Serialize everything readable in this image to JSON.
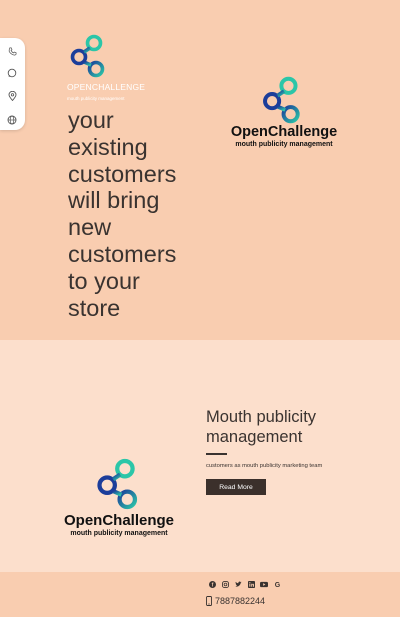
{
  "colors": {
    "hero_bg": "#f9cdb0",
    "section_bg": "#fcdfcc",
    "text_dark": "#3a3330",
    "button_bg": "#3b302b",
    "logo_blue": "#1c3d9a",
    "logo_teal": "#2bc6a8"
  },
  "contact_bar": {
    "icons": [
      "phone-icon",
      "whatsapp-icon",
      "location-pin-icon",
      "globe-icon"
    ]
  },
  "header_logo": {
    "brand": "OPENCHALLENGE",
    "tagline": "mouth publicity management"
  },
  "hero": {
    "headline_lines": [
      "your",
      "existing",
      "customers",
      "will bring",
      "new",
      "customers",
      "to your",
      "store"
    ]
  },
  "brand_logo": {
    "name": "OpenChallenge",
    "tagline": "mouth publicity management"
  },
  "section2": {
    "title": "Mouth publicity management",
    "description": "customers as mouth publicity marketing team",
    "button_label": "Read More"
  },
  "footer": {
    "social_icons": [
      "facebook-icon",
      "instagram-icon",
      "twitter-icon",
      "linkedin-icon",
      "youtube-icon",
      "google-icon"
    ],
    "phone": "7887882244"
  }
}
